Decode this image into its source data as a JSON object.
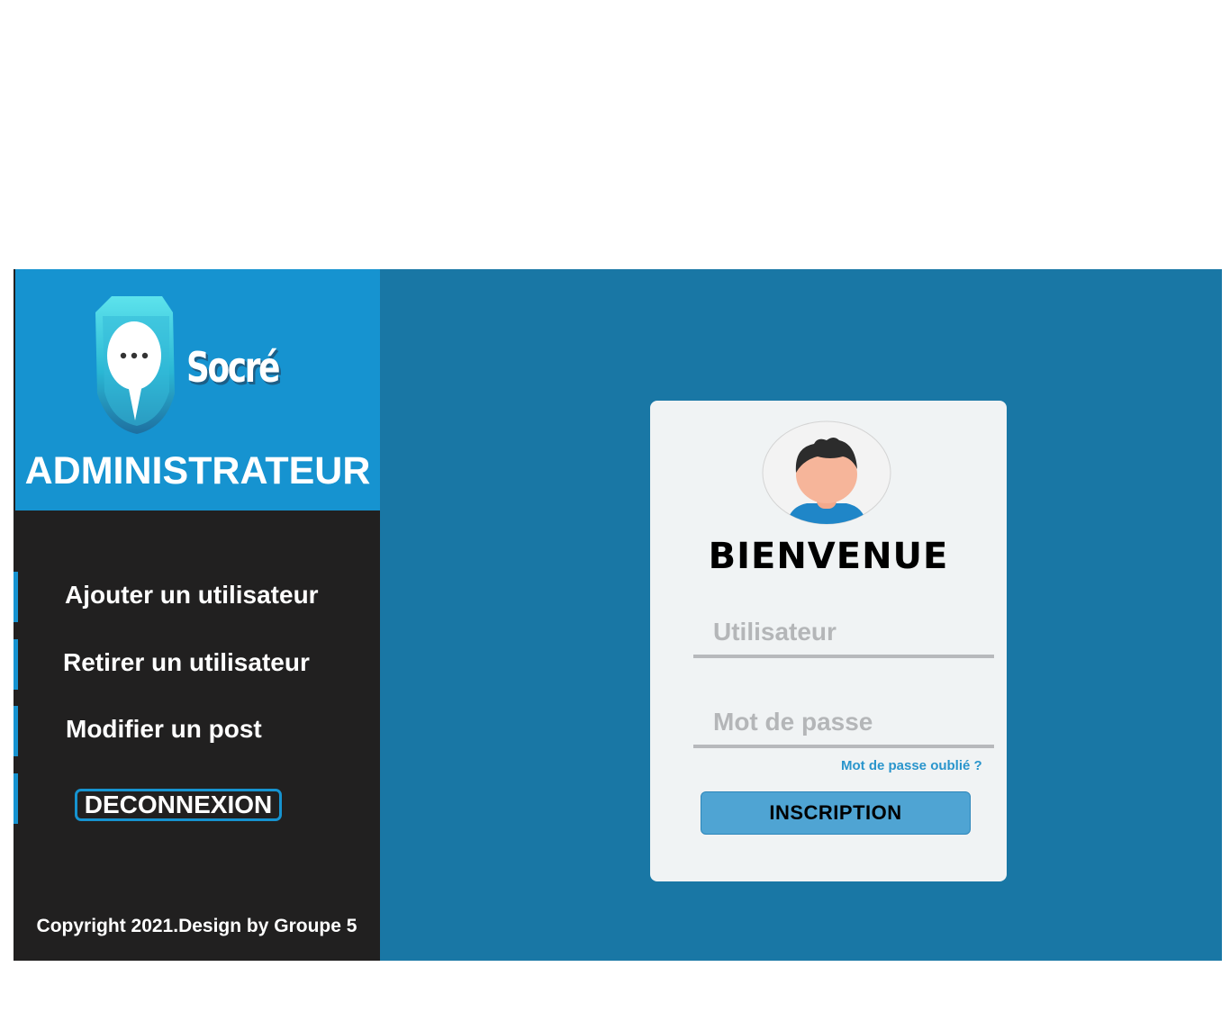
{
  "brand": {
    "name": "Socré",
    "role_title": "ADMINISTRATEUR"
  },
  "sidebar": {
    "items": [
      {
        "label": "Ajouter un utilisateur"
      },
      {
        "label": "Retirer un utilisateur"
      },
      {
        "label": "Modifier un post"
      }
    ],
    "logout_label": "DECONNEXION",
    "copyright": "Copyright 2021.Design by Groupe 5"
  },
  "login": {
    "welcome": "BIENVENUE",
    "username_placeholder": "Utilisateur",
    "username_value": "",
    "password_placeholder": "Mot de passe",
    "password_value": "",
    "forgot_label": "Mot de passe oublié ?",
    "submit_label": "INSCRIPTION"
  },
  "icons": {
    "logo": "shield-chat-icon",
    "avatar": "user-avatar-icon"
  },
  "colors": {
    "brand_blue": "#1693d0",
    "main_background": "#1977a5",
    "sidebar_background": "#212020",
    "card_background": "#f0f3f4",
    "button_background": "#4fa4d3",
    "link": "#2a95cc"
  }
}
